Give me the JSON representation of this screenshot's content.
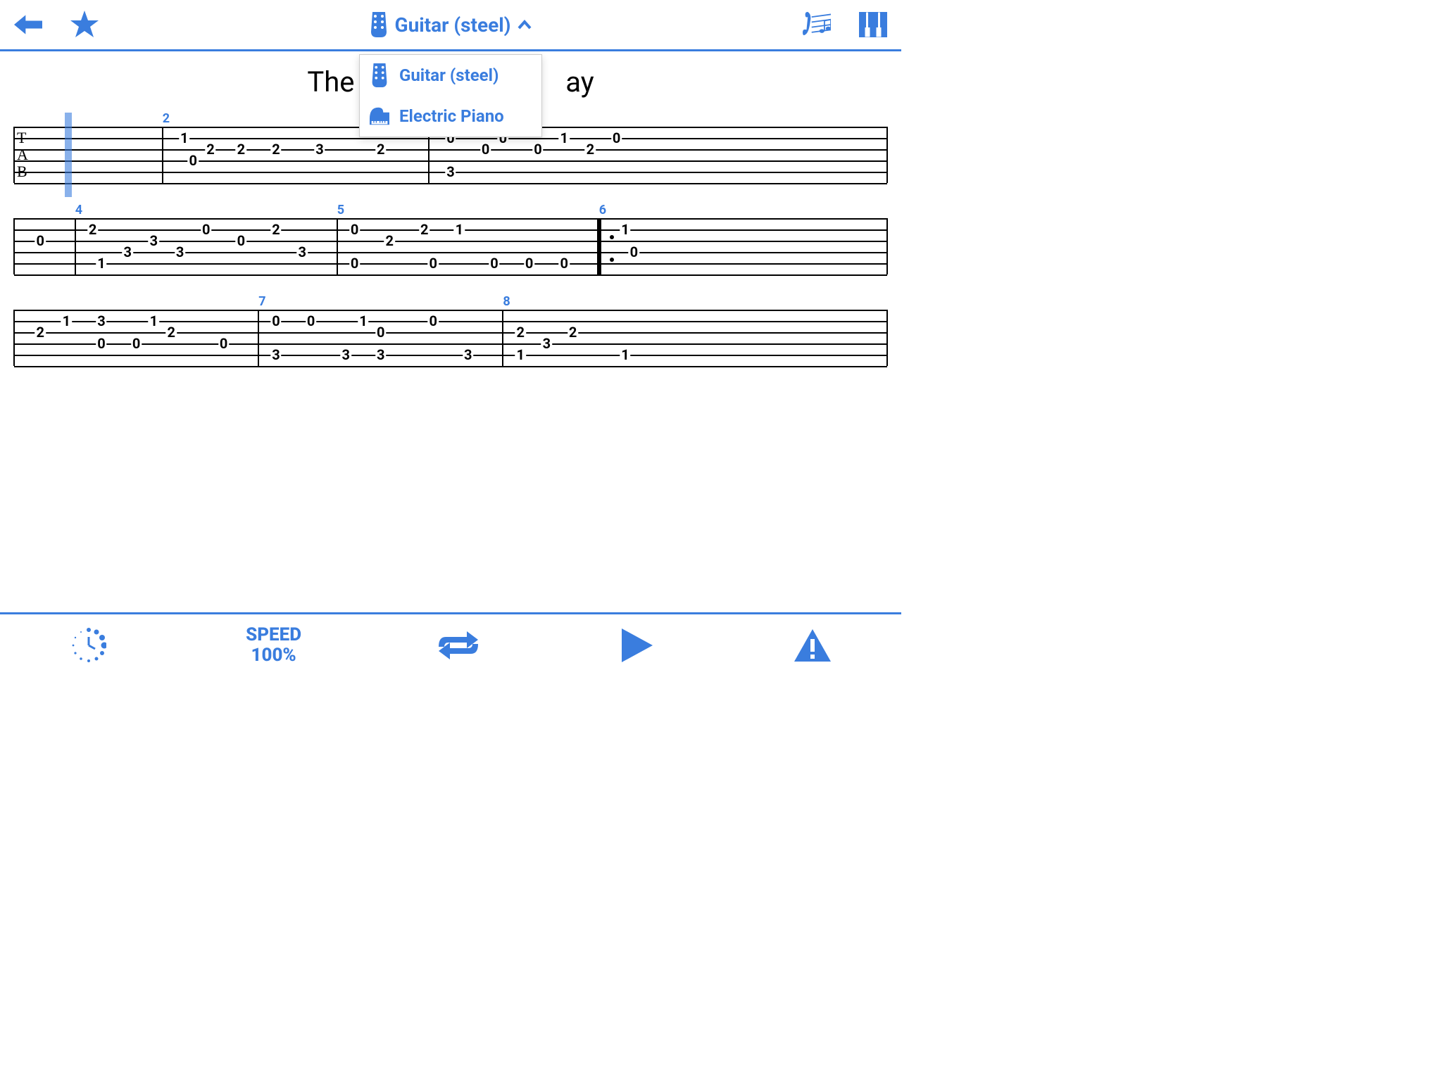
{
  "colors": {
    "accent": "#3a7dde"
  },
  "header": {
    "instrument_label": "Guitar (steel)",
    "dropdown": {
      "option1": "Guitar (steel)",
      "option2": "Electric Piano"
    }
  },
  "song": {
    "title_visible_left": "The",
    "title_visible_right": "ay"
  },
  "tab": {
    "label_line1": "T",
    "label_line2": "A",
    "label_line3": "B",
    "staffs": [
      {
        "measure_numbers": [
          {
            "pos_pct": 17,
            "num": "2"
          }
        ],
        "barlines_pct": [
          0,
          17,
          47.5,
          100
        ],
        "cursor_pct": 5.8,
        "tab_label": true,
        "notes": [
          {
            "string": 2,
            "pos_pct": 19.5,
            "fret": "1"
          },
          {
            "string": 4,
            "pos_pct": 20.5,
            "fret": "0"
          },
          {
            "string": 3,
            "pos_pct": 22.5,
            "fret": "2"
          },
          {
            "string": 3,
            "pos_pct": 26,
            "fret": "2"
          },
          {
            "string": 3,
            "pos_pct": 30,
            "fret": "2"
          },
          {
            "string": 3,
            "pos_pct": 35,
            "fret": "3"
          },
          {
            "string": 3,
            "pos_pct": 42,
            "fret": "2"
          },
          {
            "string": 2,
            "pos_pct": 50,
            "fret": "0"
          },
          {
            "string": 5,
            "pos_pct": 50,
            "fret": "3"
          },
          {
            "string": 3,
            "pos_pct": 54,
            "fret": "0"
          },
          {
            "string": 2,
            "pos_pct": 56,
            "fret": "0"
          },
          {
            "string": 3,
            "pos_pct": 60,
            "fret": "0"
          },
          {
            "string": 2,
            "pos_pct": 63,
            "fret": "1"
          },
          {
            "string": 3,
            "pos_pct": 66,
            "fret": "2"
          },
          {
            "string": 2,
            "pos_pct": 69,
            "fret": "0"
          }
        ]
      },
      {
        "measure_numbers": [
          {
            "pos_pct": 7,
            "num": "4"
          },
          {
            "pos_pct": 37,
            "num": "5"
          },
          {
            "pos_pct": 67,
            "num": "6"
          }
        ],
        "barlines_pct": [
          0,
          7,
          37,
          67,
          100
        ],
        "thick_bar_pct": 67,
        "repeat_dots_pct": 68.2,
        "notes": [
          {
            "string": 3,
            "pos_pct": 3,
            "fret": "0"
          },
          {
            "string": 2,
            "pos_pct": 9,
            "fret": "2"
          },
          {
            "string": 5,
            "pos_pct": 10,
            "fret": "1"
          },
          {
            "string": 4,
            "pos_pct": 13,
            "fret": "3"
          },
          {
            "string": 3,
            "pos_pct": 16,
            "fret": "3"
          },
          {
            "string": 4,
            "pos_pct": 19,
            "fret": "3"
          },
          {
            "string": 2,
            "pos_pct": 22,
            "fret": "0"
          },
          {
            "string": 3,
            "pos_pct": 26,
            "fret": "0"
          },
          {
            "string": 2,
            "pos_pct": 30,
            "fret": "2"
          },
          {
            "string": 4,
            "pos_pct": 33,
            "fret": "3"
          },
          {
            "string": 2,
            "pos_pct": 39,
            "fret": "0"
          },
          {
            "string": 5,
            "pos_pct": 39,
            "fret": "0"
          },
          {
            "string": 3,
            "pos_pct": 43,
            "fret": "2"
          },
          {
            "string": 2,
            "pos_pct": 47,
            "fret": "2"
          },
          {
            "string": 5,
            "pos_pct": 48,
            "fret": "0"
          },
          {
            "string": 2,
            "pos_pct": 51,
            "fret": "1"
          },
          {
            "string": 5,
            "pos_pct": 55,
            "fret": "0"
          },
          {
            "string": 5,
            "pos_pct": 59,
            "fret": "0"
          },
          {
            "string": 5,
            "pos_pct": 63,
            "fret": "0"
          },
          {
            "string": 2,
            "pos_pct": 70,
            "fret": "1"
          },
          {
            "string": 4,
            "pos_pct": 71,
            "fret": "0"
          }
        ]
      },
      {
        "measure_numbers": [
          {
            "pos_pct": 28,
            "num": "7"
          },
          {
            "pos_pct": 56,
            "num": "8"
          }
        ],
        "barlines_pct": [
          0,
          28,
          56,
          100
        ],
        "notes": [
          {
            "string": 3,
            "pos_pct": 3,
            "fret": "2"
          },
          {
            "string": 2,
            "pos_pct": 6,
            "fret": "1"
          },
          {
            "string": 2,
            "pos_pct": 10,
            "fret": "3"
          },
          {
            "string": 4,
            "pos_pct": 10,
            "fret": "0"
          },
          {
            "string": 4,
            "pos_pct": 14,
            "fret": "0"
          },
          {
            "string": 2,
            "pos_pct": 16,
            "fret": "1"
          },
          {
            "string": 3,
            "pos_pct": 18,
            "fret": "2"
          },
          {
            "string": 4,
            "pos_pct": 24,
            "fret": "0"
          },
          {
            "string": 2,
            "pos_pct": 30,
            "fret": "0"
          },
          {
            "string": 5,
            "pos_pct": 30,
            "fret": "3"
          },
          {
            "string": 2,
            "pos_pct": 34,
            "fret": "0"
          },
          {
            "string": 5,
            "pos_pct": 38,
            "fret": "3"
          },
          {
            "string": 2,
            "pos_pct": 40,
            "fret": "1"
          },
          {
            "string": 3,
            "pos_pct": 42,
            "fret": "0"
          },
          {
            "string": 5,
            "pos_pct": 42,
            "fret": "3"
          },
          {
            "string": 2,
            "pos_pct": 48,
            "fret": "0"
          },
          {
            "string": 5,
            "pos_pct": 52,
            "fret": "3"
          },
          {
            "string": 3,
            "pos_pct": 58,
            "fret": "2"
          },
          {
            "string": 5,
            "pos_pct": 58,
            "fret": "1"
          },
          {
            "string": 4,
            "pos_pct": 61,
            "fret": "3"
          },
          {
            "string": 3,
            "pos_pct": 64,
            "fret": "2"
          },
          {
            "string": 5,
            "pos_pct": 70,
            "fret": "1"
          }
        ]
      }
    ]
  },
  "footer": {
    "speed_label": "SPEED",
    "speed_value": "100%"
  }
}
